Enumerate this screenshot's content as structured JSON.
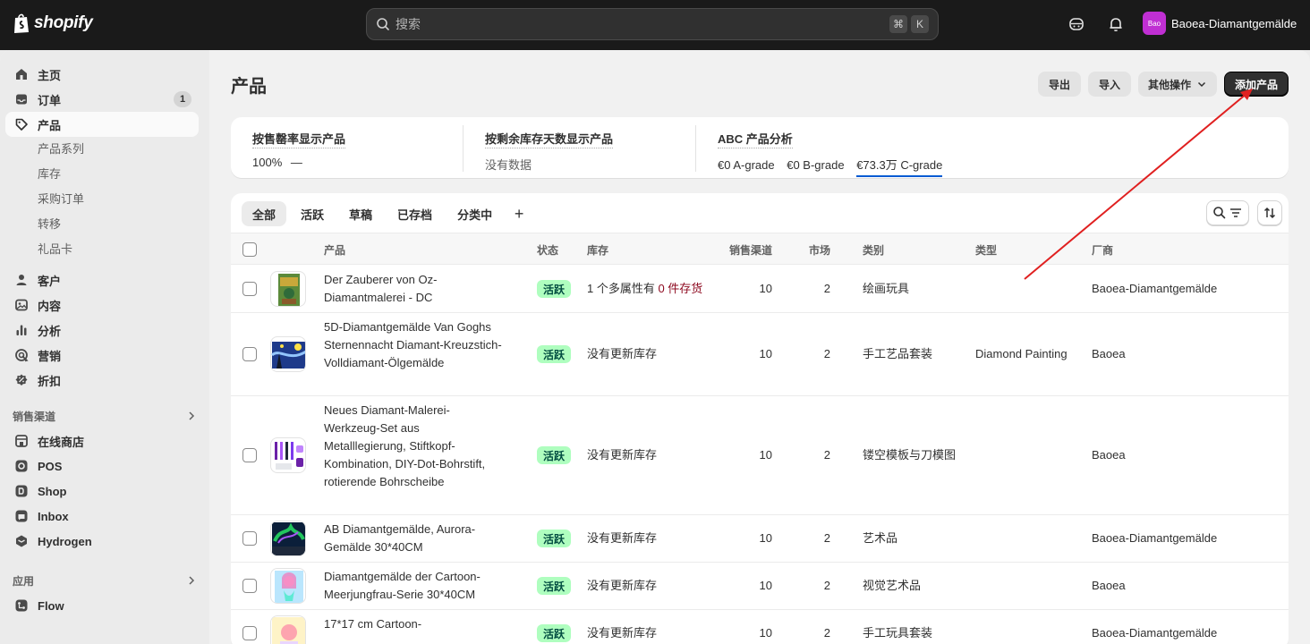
{
  "topbar": {
    "logo_text": "shopify",
    "search_placeholder": "搜索",
    "kbd_cmd": "⌘",
    "kbd_k": "K",
    "store_avatar": "Bao",
    "store_name": "Baoea-Diamantgemälde"
  },
  "sidebar": {
    "main_items": [
      {
        "label": "主页",
        "icon": "home-icon"
      },
      {
        "label": "订单",
        "icon": "inbox-icon",
        "count": "1"
      },
      {
        "label": "产品",
        "icon": "tag-icon"
      }
    ],
    "product_sub": [
      "产品系列",
      "库存",
      "采购订单",
      "转移",
      "礼品卡"
    ],
    "more_items": [
      {
        "label": "客户",
        "icon": "person-icon"
      },
      {
        "label": "内容",
        "icon": "content-icon"
      },
      {
        "label": "分析",
        "icon": "chart-icon"
      },
      {
        "label": "营销",
        "icon": "target-icon"
      },
      {
        "label": "折扣",
        "icon": "discount-icon"
      }
    ],
    "channels_title": "销售渠道",
    "channels": [
      {
        "label": "在线商店",
        "icon": "store-icon"
      },
      {
        "label": "POS",
        "icon": "pos-icon"
      },
      {
        "label": "Shop",
        "icon": "shop-icon"
      },
      {
        "label": "Inbox",
        "icon": "inbox-app-icon"
      },
      {
        "label": "Hydrogen",
        "icon": "hydrogen-icon"
      }
    ],
    "apps_title": "应用",
    "apps": [
      {
        "label": "Flow",
        "icon": "flow-icon"
      }
    ]
  },
  "page": {
    "title": "产品",
    "export_label": "导出",
    "import_label": "导入",
    "more_actions_label": "其他操作",
    "add_product_label": "添加产品"
  },
  "stats": {
    "sell_through_title": "按售罄率显示产品",
    "sell_through_value": "100%",
    "sell_through_dash": "—",
    "days_left_title": "按剩余库存天数显示产品",
    "days_left_value": "没有数据",
    "abc_title": "ABC 产品分析",
    "grades": [
      "€0 A-grade",
      "€0 B-grade",
      "€73.3万 C-grade"
    ]
  },
  "tabs": [
    "全部",
    "活跃",
    "草稿",
    "已存档",
    "分类中"
  ],
  "tab_add": "+",
  "table": {
    "headers": {
      "product": "产品",
      "status": "状态",
      "inventory": "库存",
      "channels": "销售渠道",
      "markets": "市场",
      "category": "类别",
      "type": "类型",
      "vendor": "厂商"
    },
    "rows": [
      {
        "name": "Der Zauberer von Oz-Diamantmalerei - DC",
        "status": "活跃",
        "inventory_prefix": "1 个多属性有 ",
        "inventory_red": "0 件存货",
        "channels": "10",
        "markets": "2",
        "category": "绘画玩具",
        "type": "",
        "vendor": "Baoea-Diamantgemälde"
      },
      {
        "name": "5D-Diamantgemälde Van Goghs Sternennacht Diamant-Kreuzstich-Volldiamant-Ölgemälde",
        "status": "活跃",
        "inventory_prefix": "没有更新库存",
        "inventory_red": "",
        "channels": "10",
        "markets": "2",
        "category": "手工艺品套装",
        "type": "Diamond Painting",
        "vendor": "Baoea"
      },
      {
        "name": "Neues Diamant-Malerei-Werkzeug-Set aus Metalllegierung, Stiftkopf-Kombination, DIY-Dot-Bohrstift, rotierende Bohrscheibe",
        "status": "活跃",
        "inventory_prefix": "没有更新库存",
        "inventory_red": "",
        "channels": "10",
        "markets": "2",
        "category": "镂空模板与刀模图",
        "type": "",
        "vendor": "Baoea"
      },
      {
        "name": "AB Diamantgemälde, Aurora-Gemälde 30*40CM",
        "status": "活跃",
        "inventory_prefix": "没有更新库存",
        "inventory_red": "",
        "channels": "10",
        "markets": "2",
        "category": "艺术品",
        "type": "",
        "vendor": "Baoea-Diamantgemälde"
      },
      {
        "name": "Diamantgemälde der Cartoon-Meerjungfrau-Serie 30*40CM",
        "status": "活跃",
        "inventory_prefix": "没有更新库存",
        "inventory_red": "",
        "channels": "10",
        "markets": "2",
        "category": "视觉艺术品",
        "type": "",
        "vendor": "Baoea"
      },
      {
        "name": "17*17 cm Cartoon-",
        "status": "活跃",
        "inventory_prefix": "没有更新库存",
        "inventory_red": "",
        "channels": "10",
        "markets": "2",
        "category": "手工玩具套装",
        "type": "",
        "vendor": "Baoea-Diamantgemälde"
      }
    ]
  },
  "colors": {
    "topbar": "#1a1a1a",
    "primary_button": "#303030",
    "status_active_bg": "#affebf",
    "status_active_text": "#014b40",
    "inventory_warning": "#8e0b21",
    "grade_underline": "#005bd3",
    "annotation_arrow": "#e02020"
  }
}
